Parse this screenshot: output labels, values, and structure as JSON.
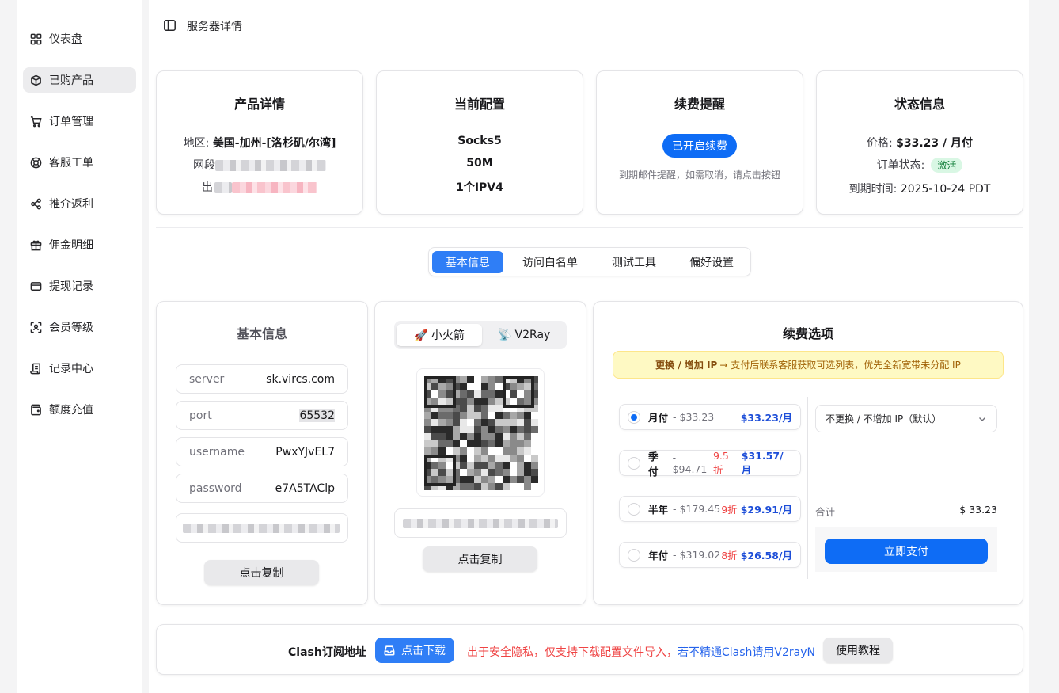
{
  "sidebar": {
    "items": [
      {
        "label": "仪表盘",
        "icon": "dashboard-icon",
        "active": false
      },
      {
        "label": "已购产品",
        "icon": "box-icon",
        "active": true
      },
      {
        "label": "订单管理",
        "icon": "cart-icon",
        "active": false
      },
      {
        "label": "客服工单",
        "icon": "lifebuoy-icon",
        "active": false
      },
      {
        "label": "推介返利",
        "icon": "share-icon",
        "active": false
      },
      {
        "label": "佣金明细",
        "icon": "gift-icon",
        "active": false
      },
      {
        "label": "提现记录",
        "icon": "credit-card-icon",
        "active": false
      },
      {
        "label": "会员等级",
        "icon": "scan-user-icon",
        "active": false
      },
      {
        "label": "记录中心",
        "icon": "scroll-icon",
        "active": false
      },
      {
        "label": "额度充值",
        "icon": "wallet-icon",
        "active": false
      }
    ]
  },
  "header": {
    "title": "服务器详情"
  },
  "cards": {
    "product": {
      "title": "产品详情",
      "region_label": "地区:",
      "region_value": "美国-加州-[洛杉矶/尔湾]",
      "segment_label": "网段",
      "exit_label": "出"
    },
    "config": {
      "title": "当前配置",
      "lines": [
        "Socks5",
        "50M",
        "1个IPV4"
      ]
    },
    "renew": {
      "title": "续费提醒",
      "button": "已开启续费",
      "hint": "到期邮件提醒，如需取消，请点击按钮"
    },
    "status": {
      "title": "状态信息",
      "price_label": "价格:",
      "price_value": "$33.23 / 月付",
      "order_label": "订单状态:",
      "order_value": "激活",
      "expire_label": "到期时间:",
      "expire_value": "2025-10-24 PDT"
    }
  },
  "tabs": [
    "基本信息",
    "访问白名单",
    "测试工具",
    "偏好设置"
  ],
  "basic": {
    "title": "基本信息",
    "fields": [
      {
        "key": "server",
        "value": "sk.vircs.com"
      },
      {
        "key": "port",
        "value": "65532"
      },
      {
        "key": "username",
        "value": "PwxYJvEL7"
      },
      {
        "key": "password",
        "value": "e7A5TAClp"
      }
    ],
    "copy": "点击复制"
  },
  "qr": {
    "tabs": [
      "🚀 小火箭",
      "📡 V2Ray"
    ],
    "copy": "点击复制"
  },
  "renewal": {
    "title": "续费选项",
    "notice_bold": "更换 / 增加 IP",
    "notice_text": "→ 支付后联系客服获取可选列表，优先全新宽带未分配 IP",
    "plans": [
      {
        "name": "月付",
        "orig": "- $33.23",
        "discount": "",
        "price": "$33.23/月",
        "selected": true
      },
      {
        "name": "季付",
        "orig": "- $94.71",
        "discount": "9.5折",
        "price": "$31.57/月",
        "selected": false
      },
      {
        "name": "半年",
        "orig": "- $179.45",
        "discount": "9折",
        "price": "$29.91/月",
        "selected": false
      },
      {
        "name": "年付",
        "orig": "- $319.02",
        "discount": "8折",
        "price": "$26.58/月",
        "selected": false
      }
    ],
    "ip_select": "不更换 / 不增加 IP（默认）",
    "total_label": "合计",
    "total_value": "$ 33.23",
    "pay": "立即支付"
  },
  "clash": {
    "label": "Clash订阅地址",
    "download": "点击下载",
    "warning_red": "出于安全隐私，仅支持下载配置文件导入，",
    "warning_blue": "若不精通Clash请用V2rayN",
    "tutorial": "使用教程"
  },
  "colors": {
    "accent": "#0e6cf5",
    "tab_active": "#2f7ef6",
    "discount": "#ef4444",
    "price": "#1d4ed8"
  }
}
